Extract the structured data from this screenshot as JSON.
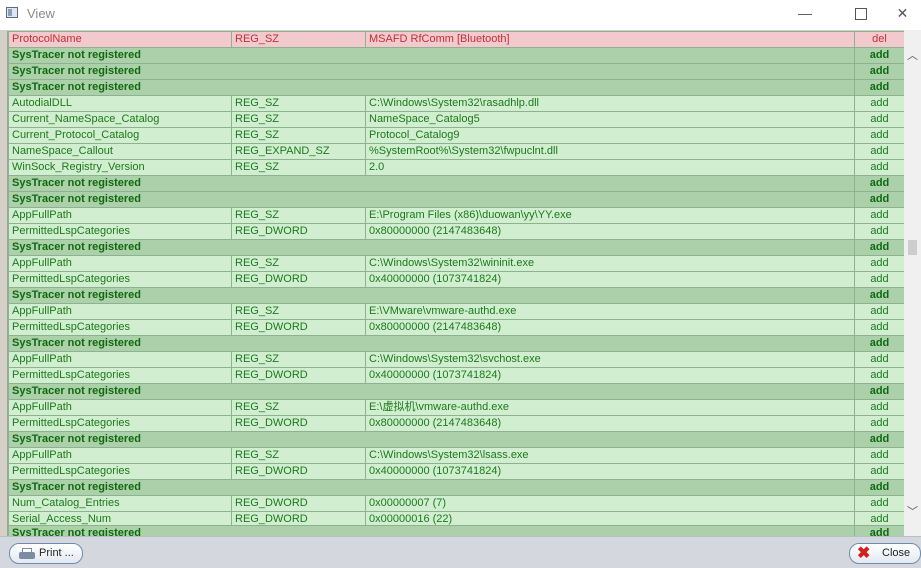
{
  "window": {
    "title": "View"
  },
  "title_controls": {
    "minimize_glyph": "—",
    "close_glyph": "✕"
  },
  "scrollbar": {
    "up_glyph": "︿",
    "down_glyph": "﹀"
  },
  "rows": [
    {
      "kind": "del",
      "name": "ProtocolName",
      "type": "REG_SZ",
      "value": "MSAFD RfComm [Bluetooth]",
      "action": "del"
    },
    {
      "kind": "sys",
      "name": "SysTracer not registered",
      "action": "add"
    },
    {
      "kind": "sys",
      "name": "SysTracer not registered",
      "action": "add"
    },
    {
      "kind": "sys",
      "name": "SysTracer not registered",
      "action": "add"
    },
    {
      "kind": "reg",
      "name": "AutodialDLL",
      "type": "REG_SZ",
      "value": "C:\\Windows\\System32\\rasadhlp.dll",
      "action": "add"
    },
    {
      "kind": "reg",
      "name": "Current_NameSpace_Catalog",
      "type": "REG_SZ",
      "value": "NameSpace_Catalog5",
      "action": "add"
    },
    {
      "kind": "reg",
      "name": "Current_Protocol_Catalog",
      "type": "REG_SZ",
      "value": "Protocol_Catalog9",
      "action": "add"
    },
    {
      "kind": "reg",
      "name": "NameSpace_Callout",
      "type": "REG_EXPAND_SZ",
      "value": "%SystemRoot%\\System32\\fwpuclnt.dll",
      "action": "add"
    },
    {
      "kind": "reg",
      "name": "WinSock_Registry_Version",
      "type": "REG_SZ",
      "value": "2.0",
      "action": "add"
    },
    {
      "kind": "sys",
      "name": "SysTracer not registered",
      "action": "add"
    },
    {
      "kind": "sys",
      "name": "SysTracer not registered",
      "action": "add"
    },
    {
      "kind": "reg",
      "name": "AppFullPath",
      "type": "REG_SZ",
      "value": "E:\\Program Files (x86)\\duowan\\yy\\YY.exe",
      "action": "add"
    },
    {
      "kind": "reg",
      "name": "PermittedLspCategories",
      "type": "REG_DWORD",
      "value": "0x80000000 (2147483648)",
      "action": "add"
    },
    {
      "kind": "sys",
      "name": "SysTracer not registered",
      "action": "add"
    },
    {
      "kind": "reg",
      "name": "AppFullPath",
      "type": "REG_SZ",
      "value": "C:\\Windows\\System32\\wininit.exe",
      "action": "add"
    },
    {
      "kind": "reg",
      "name": "PermittedLspCategories",
      "type": "REG_DWORD",
      "value": "0x40000000 (1073741824)",
      "action": "add"
    },
    {
      "kind": "sys",
      "name": "SysTracer not registered",
      "action": "add"
    },
    {
      "kind": "reg",
      "name": "AppFullPath",
      "type": "REG_SZ",
      "value": "E:\\VMware\\vmware-authd.exe",
      "action": "add"
    },
    {
      "kind": "reg",
      "name": "PermittedLspCategories",
      "type": "REG_DWORD",
      "value": "0x80000000 (2147483648)",
      "action": "add"
    },
    {
      "kind": "sys",
      "name": "SysTracer not registered",
      "action": "add"
    },
    {
      "kind": "reg",
      "name": "AppFullPath",
      "type": "REG_SZ",
      "value": "C:\\Windows\\System32\\svchost.exe",
      "action": "add"
    },
    {
      "kind": "reg",
      "name": "PermittedLspCategories",
      "type": "REG_DWORD",
      "value": "0x40000000 (1073741824)",
      "action": "add"
    },
    {
      "kind": "sys",
      "name": "SysTracer not registered",
      "action": "add"
    },
    {
      "kind": "reg",
      "name": "AppFullPath",
      "type": "REG_SZ",
      "value": "E:\\虚拟机\\vmware-authd.exe",
      "action": "add"
    },
    {
      "kind": "reg",
      "name": "PermittedLspCategories",
      "type": "REG_DWORD",
      "value": "0x80000000 (2147483648)",
      "action": "add"
    },
    {
      "kind": "sys",
      "name": "SysTracer not registered",
      "action": "add"
    },
    {
      "kind": "reg",
      "name": "AppFullPath",
      "type": "REG_SZ",
      "value": "C:\\Windows\\System32\\lsass.exe",
      "action": "add"
    },
    {
      "kind": "reg",
      "name": "PermittedLspCategories",
      "type": "REG_DWORD",
      "value": "0x40000000 (1073741824)",
      "action": "add"
    },
    {
      "kind": "sys",
      "name": "SysTracer not registered",
      "action": "add"
    },
    {
      "kind": "reg",
      "name": "Num_Catalog_Entries",
      "type": "REG_DWORD",
      "value": "0x00000007 (7)",
      "action": "add"
    },
    {
      "kind": "reg",
      "name": "Serial_Access_Num",
      "type": "REG_DWORD",
      "value": "0x00000016 (22)",
      "action": "add"
    }
  ],
  "cut_row": {
    "kind": "sys",
    "name": "SysTracer not registered",
    "action": "add"
  },
  "footer": {
    "print_label": "Print ...",
    "close_label": "Close"
  }
}
